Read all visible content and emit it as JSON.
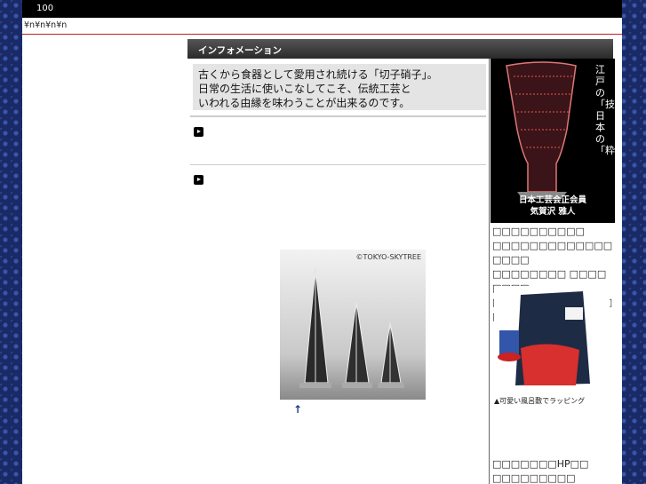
{
  "topbar": {
    "number": "100"
  },
  "breadcrumb": "¥n¥n¥n¥n",
  "info": {
    "header": "インフォメーション",
    "intro_lines": [
      "古くから食器として愛用され続ける「切子硝子」。",
      "日常の生活に使いこなしてこそ、伝統工芸と",
      "いわれる由縁を味わうことが出来るのです。"
    ]
  },
  "tower_photo": {
    "copyright": "©TOKYO-SKYTREE"
  },
  "sidebar": {
    "ad": {
      "vertical_text": "江戸の「技」日本の「粋」",
      "member_line1": "日本工芸会正会員",
      "member_line2": "気賀沢 雅人"
    },
    "text_lines": [
      "□□□□□□□□□□",
      "□□□□□□□□□□□□□□□□□",
      "□□□□□□□□ □□□□□□□□",
      "□□□□□□□□□□□□□□"
    ],
    "wrap_caption": "▲可愛い風呂敷でラッピング",
    "bottom_lines": [
      "□□□□□□□HP□□",
      "□□□□□□□□□"
    ]
  }
}
